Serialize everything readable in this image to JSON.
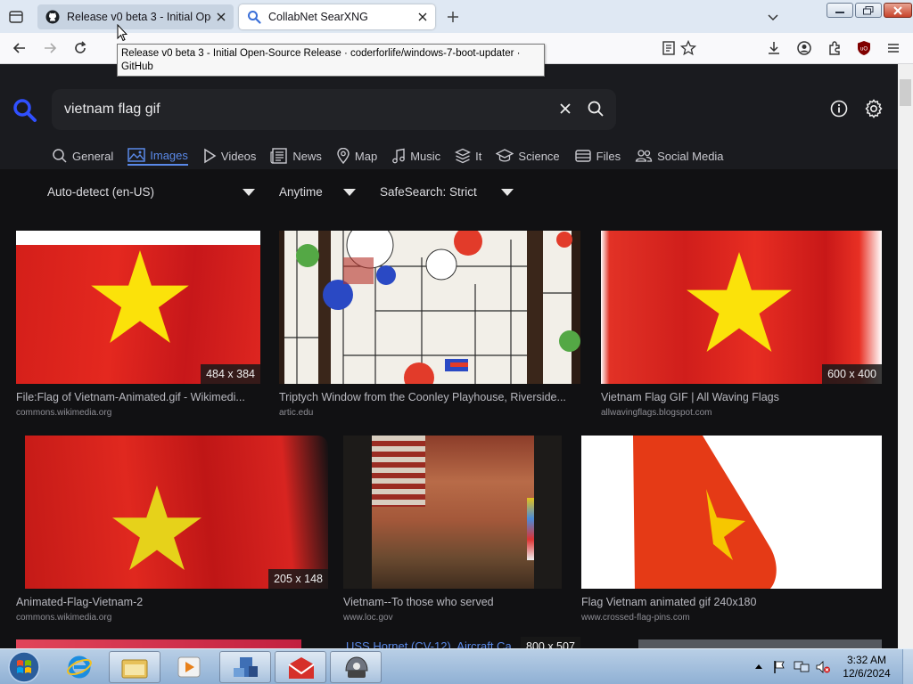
{
  "tabs": [
    {
      "title": "Release v0 beta 3 - Initial Open-Source Release - coderforlife/windows-7-boot-updater - GitHub",
      "icon": "github-icon",
      "active": false
    },
    {
      "title": "CollabNet SearXNG",
      "icon": "search-icon",
      "active": true
    }
  ],
  "tooltip": "Release v0 beta 3 - Initial Open-Source Release · coderforlife/windows-7-boot-updater · GitHub",
  "search": {
    "query": "vietnam flag gif"
  },
  "categories": [
    {
      "label": "General",
      "icon": "search-icon"
    },
    {
      "label": "Images",
      "icon": "image-icon",
      "active": true
    },
    {
      "label": "Videos",
      "icon": "play-icon"
    },
    {
      "label": "News",
      "icon": "newspaper-icon"
    },
    {
      "label": "Map",
      "icon": "map-pin-icon"
    },
    {
      "label": "Music",
      "icon": "music-note-icon"
    },
    {
      "label": "It",
      "icon": "layers-icon"
    },
    {
      "label": "Science",
      "icon": "graduation-cap-icon"
    },
    {
      "label": "Files",
      "icon": "drive-icon"
    },
    {
      "label": "Social Media",
      "icon": "users-icon"
    }
  ],
  "filters": {
    "language": "Auto-detect (en-US)",
    "time": "Anytime",
    "safesearch": "SafeSearch: Strict"
  },
  "results": [
    {
      "title": "File:Flag of Vietnam-Animated.gif - Wikimedi...",
      "url": "commons.wikimedia.org",
      "dims": "484 x 384"
    },
    {
      "title": "Triptych Window from the Coonley Playhouse, Riverside...",
      "url": "artic.edu",
      "dims": ""
    },
    {
      "title": "Vietnam Flag GIF | All Waving Flags",
      "url": "allwavingflags.blogspot.com",
      "dims": "600 x 400"
    },
    {
      "title": "Animated-Flag-Vietnam-2",
      "url": "commons.wikimedia.org",
      "dims": "205 x 148"
    },
    {
      "title": "Vietnam--To those who served",
      "url": "www.loc.gov",
      "dims": ""
    },
    {
      "title": "Flag Vietnam animated gif 240x180",
      "url": "www.crossed-flag-pins.com",
      "dims": ""
    },
    {
      "title": "USS Hornet (CV-12), Aircraft Ca...",
      "url": "",
      "dims": "800 x 507"
    }
  ],
  "clock": {
    "time": "3:32 AM",
    "date": "12/6/2024"
  },
  "colors": {
    "accent": "#5a89e8",
    "page_bg": "#111113",
    "flag_red": "#d8231c",
    "flag_yellow": "#fbe20a"
  }
}
